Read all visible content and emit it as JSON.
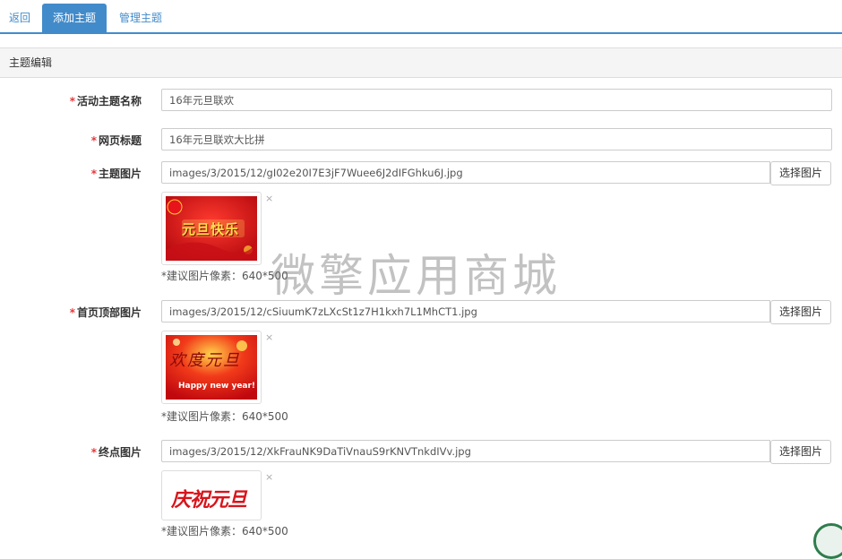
{
  "tabs": {
    "back": "返回",
    "add": "添加主题",
    "manage": "管理主题"
  },
  "panel": {
    "heading": "主题编辑"
  },
  "form": {
    "required_mark": "*",
    "name_label": "活动主题名称",
    "name_value": "16年元旦联欢",
    "page_title_label": "网页标题",
    "page_title_value": "16年元旦联欢大比拼",
    "theme_image_label": "主题图片",
    "theme_image_path": "images/3/2015/12/gI02e20I7E3jF7Wuee6J2dIFGhku6J.jpg",
    "home_top_image_label": "首页顶部图片",
    "home_top_image_path": "images/3/2015/12/cSiuumK7zLXcSt1z7H1kxh7L1MhCT1.jpg",
    "end_image_label": "终点图片",
    "end_image_path": "images/3/2015/12/XkFrauNK9DaTiVnauS9rKNVTnkdIVv.jpg",
    "select_image_button": "选择图片",
    "size_hint": "*建议图片像素：640*500",
    "remove_symbol": "×"
  },
  "images": {
    "theme_caption": "元旦快乐",
    "home_top_caption": "欢度元旦",
    "home_top_subcaption": "Happy new year!",
    "end_caption": "庆祝元旦"
  },
  "watermark": "微擎应用商城",
  "colors": {
    "accent": "#428bca",
    "required": "#e4393c",
    "banner_red": "#d8141b",
    "banner_gold": "#ffd700"
  }
}
